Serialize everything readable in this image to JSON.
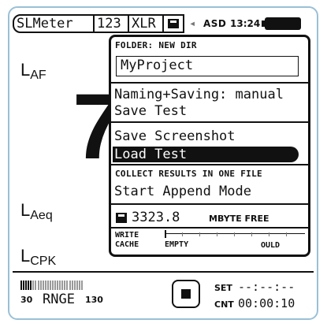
{
  "status_bar": {
    "tabs": [
      "SLMeter",
      "123",
      "XLR"
    ],
    "save_icon": "floppy-icon",
    "speaker_icon": "speaker-icon",
    "device_label": "ASD",
    "time": "13:24",
    "battery_icon": "battery-icon"
  },
  "meter": {
    "labels": [
      {
        "base": "L",
        "sub": "AF"
      },
      {
        "base": "L",
        "sub": "Aeq"
      },
      {
        "base": "L",
        "sub": "CPK"
      }
    ],
    "big_digit": "7"
  },
  "menu": {
    "folder_title": "FOLDER: NEW DIR",
    "folder_value": "MyProject",
    "naming_saving": "Naming+Saving: manual",
    "save_test": "Save Test",
    "save_screenshot": "Save Screenshot",
    "load_test": "Load Test",
    "collect_title": "COLLECT RESULTS IN ONE FILE",
    "start_append": "Start Append Mode",
    "free_space": "3323.8",
    "free_unit": "MBYTE FREE",
    "write_label_1": "WRITE",
    "write_label_2": "CACHE",
    "cache_state": "EMPTY",
    "cache_end": "OULD"
  },
  "bottom": {
    "range_label": "RNGE",
    "range_low": "30",
    "range_high": "130",
    "range_level_fraction": 0.2,
    "stop_icon": "stop-icon",
    "set_label": "SET",
    "set_value": "--:--:--",
    "cnt_label": "CNT",
    "cnt_value": "00:00:10"
  }
}
